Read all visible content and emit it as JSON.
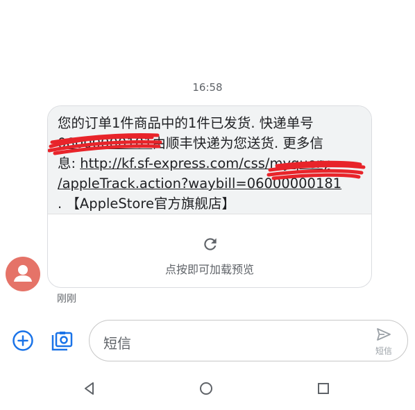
{
  "conversation": {
    "timestamp": "16:58",
    "sent_time": "刚刚",
    "message": {
      "line1": "您的订单1件商品中的1件已发货. 快递单号",
      "line2_redacted": "06000000181",
      "line2": "由顺丰快递为您送货. 更多信",
      "line3_prefix": "息: ",
      "line3_link": "http://kf.sf-express.com/css/myquery",
      "line4_link": "/appleTrack.action?waybill=06000000181",
      "line5": ". 【AppleStore官方旗舰店】"
    },
    "preview": {
      "label": "点按即可加载预览"
    }
  },
  "composer": {
    "placeholder": "短信",
    "send_label": "短信"
  },
  "colors": {
    "avatar": "#e57368",
    "accent_blue": "#1a73e8",
    "bubble_background": "#f1f3f4",
    "redaction_scribble": "#e8242a"
  },
  "icons": [
    "person-icon",
    "refresh-icon",
    "add-icon",
    "gallery-icon",
    "send-icon",
    "back-icon",
    "home-icon",
    "recents-icon"
  ]
}
